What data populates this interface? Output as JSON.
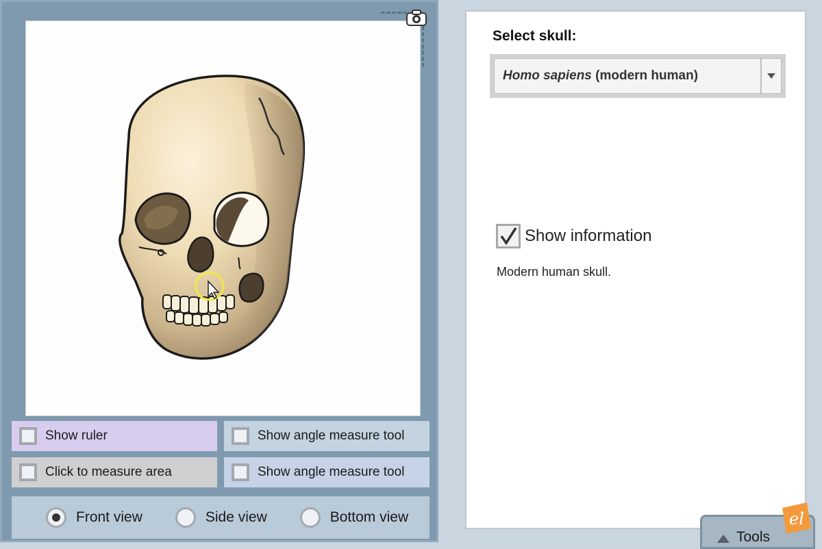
{
  "simulation": {
    "camera_icon": "camera-icon",
    "skull_image": "modern-human-skull-front-view",
    "checkboxes": {
      "show_ruler": {
        "label": "Show ruler",
        "checked": false
      },
      "measure_area": {
        "label": "Click to measure area",
        "checked": false
      },
      "angle_tool_1": {
        "label": "Show angle measure tool",
        "checked": false
      },
      "angle_tool_2": {
        "label": "Show angle measure tool",
        "checked": false
      }
    },
    "views": {
      "front": {
        "label": "Front view",
        "selected": true
      },
      "side": {
        "label": "Side view",
        "selected": false
      },
      "bottom": {
        "label": "Bottom view",
        "selected": false
      }
    }
  },
  "sidebar": {
    "select_label": "Select skull:",
    "select_value_species": "Homo sapiens",
    "select_value_common": " (modern human)",
    "show_information_label": "Show information",
    "show_information_checked": true,
    "information_text": "Modern human skull."
  },
  "tools_tab": {
    "label": "Tools"
  },
  "brand": {
    "logo": "explorelearning-logo",
    "accent": "#f39a3c"
  },
  "colors": {
    "panel": "#7f9aae",
    "ruler_row": "#d8cdee",
    "area_row": "#cfcfcf"
  }
}
